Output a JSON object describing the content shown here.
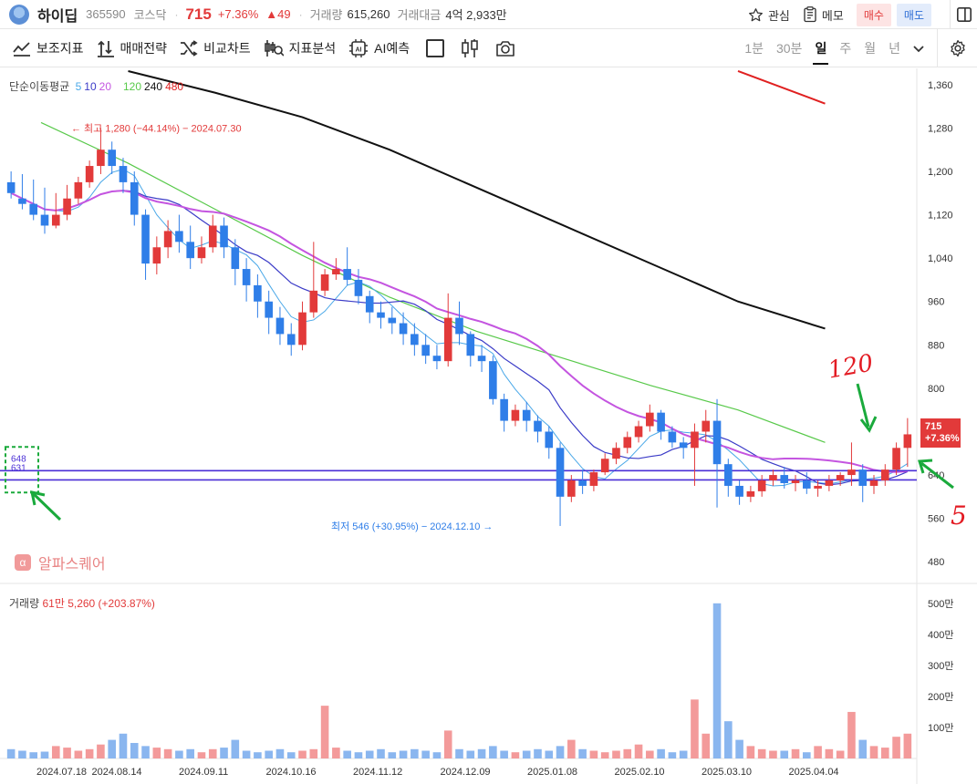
{
  "header": {
    "name": "하이딥",
    "code": "365590",
    "market": "코스닥",
    "dot": "·",
    "price": "715",
    "change_pct": "+7.36%",
    "change_abs": "▲49",
    "volume_label": "거래량",
    "volume_value": "615,260",
    "amount_label": "거래대금",
    "amount_value": "4억 2,933만",
    "watch_label": "관심",
    "memo_label": "메모",
    "buy_label": "매수",
    "sell_label": "매도"
  },
  "toolbar": {
    "indicators": "보조지표",
    "strategy": "매매전략",
    "compare": "비교차트",
    "indicator_analysis": "지표분석",
    "ai_predict": "AI예측",
    "timeframes": [
      "1분",
      "30분",
      "일",
      "주",
      "월",
      "년"
    ],
    "active_timeframe": "일"
  },
  "chart": {
    "ma_title": "단순이동평균",
    "ma_periods": [
      {
        "label": "5",
        "color": "#4aa8e8"
      },
      {
        "label": "10",
        "color": "#3b3bc7"
      },
      {
        "label": "20",
        "color": "#c455e0"
      },
      {
        "label": "120",
        "color": "#58c94a"
      },
      {
        "label": "240",
        "color": "#111111"
      },
      {
        "label": "480",
        "color": "#e02020"
      }
    ],
    "high_note": "최고 1,280 (−44.14%) − 2024.07.30",
    "low_note": "최저 546 (+30.95%) − 2024.12.10",
    "level_labels": [
      "648",
      "631"
    ],
    "price_tag": {
      "price": "715",
      "pct": "+7.36%"
    },
    "brand": "알파스퀘어",
    "volume_title": "거래량",
    "volume_info": "61만 5,260 (+203.87%)",
    "annotation_120": "120",
    "annotation_5": "5",
    "y_ticks": [
      "1,360",
      "1,280",
      "1,200",
      "1,120",
      "1,040",
      "960",
      "880",
      "800",
      "640",
      "560",
      "480"
    ],
    "y_ticks_values": [
      1360,
      1280,
      1200,
      1120,
      1040,
      960,
      880,
      800,
      640,
      560,
      480
    ],
    "volume_ticks": [
      "500만",
      "400만",
      "300만",
      "200만",
      "100만"
    ],
    "x_ticks": [
      "2024.07.18",
      "2024.08.14",
      "2024.09.11",
      "2024.10.16",
      "2024.11.12",
      "2024.12.09",
      "2025.01.08",
      "2025.02.10",
      "2025.03.10",
      "2025.04.04"
    ],
    "colors": {
      "up": "#e23a3a",
      "down": "#2f7ee8",
      "level": "#4a2fd6"
    }
  },
  "chart_data": {
    "type": "candlestick",
    "ylim": [
      440,
      1390
    ],
    "levels": [
      648,
      631
    ],
    "ma_lines": [
      {
        "name": "120",
        "color": "#58c94a",
        "points": [
          [
            "2024.07.18",
            1290
          ],
          [
            "2024.08.14",
            1215
          ],
          [
            "2024.09.11",
            1130
          ],
          [
            "2024.10.16",
            1045
          ],
          [
            "2024.11.12",
            968
          ],
          [
            "2024.12.09",
            905
          ],
          [
            "2025.01.08",
            855
          ],
          [
            "2025.02.10",
            805
          ],
          [
            "2025.03.10",
            760
          ],
          [
            "2025.04.04",
            700
          ]
        ]
      },
      {
        "name": "240",
        "color": "#111111",
        "points": [
          [
            "2024.08.14",
            1385
          ],
          [
            "2024.09.11",
            1345
          ],
          [
            "2024.10.16",
            1300
          ],
          [
            "2024.11.12",
            1240
          ],
          [
            "2024.12.09",
            1170
          ],
          [
            "2025.01.08",
            1100
          ],
          [
            "2025.02.10",
            1030
          ],
          [
            "2025.03.10",
            960
          ],
          [
            "2025.04.04",
            910
          ]
        ]
      },
      {
        "name": "480",
        "color": "#e02020",
        "points": [
          [
            "2025.03.10",
            1385
          ],
          [
            "2025.04.04",
            1325
          ]
        ]
      }
    ],
    "candles": [
      [
        1180,
        1200,
        1160,
        1150
      ],
      [
        1150,
        1195,
        1140,
        1130
      ],
      [
        1140,
        1185,
        1120,
        1110
      ],
      [
        1120,
        1170,
        1100,
        1085
      ],
      [
        1100,
        1160,
        1120,
        1095
      ],
      [
        1120,
        1175,
        1150,
        1110
      ],
      [
        1150,
        1190,
        1180,
        1140
      ],
      [
        1180,
        1220,
        1210,
        1170
      ],
      [
        1210,
        1280,
        1240,
        1195
      ],
      [
        1240,
        1255,
        1210,
        1195
      ],
      [
        1210,
        1225,
        1180,
        1160
      ],
      [
        1180,
        1200,
        1120,
        1100
      ],
      [
        1120,
        1130,
        1030,
        1000
      ],
      [
        1030,
        1080,
        1060,
        1010
      ],
      [
        1060,
        1110,
        1090,
        1040
      ],
      [
        1090,
        1120,
        1070,
        1050
      ],
      [
        1070,
        1100,
        1040,
        1020
      ],
      [
        1040,
        1080,
        1060,
        1030
      ],
      [
        1060,
        1120,
        1100,
        1050
      ],
      [
        1100,
        1115,
        1060,
        1040
      ],
      [
        1060,
        1075,
        1020,
        990
      ],
      [
        1020,
        1040,
        990,
        960
      ],
      [
        990,
        1010,
        960,
        930
      ],
      [
        960,
        980,
        930,
        900
      ],
      [
        930,
        950,
        900,
        880
      ],
      [
        900,
        920,
        880,
        860
      ],
      [
        880,
        960,
        940,
        870
      ],
      [
        940,
        1070,
        980,
        930
      ],
      [
        980,
        1020,
        1010,
        970
      ],
      [
        1010,
        1040,
        1020,
        1000
      ],
      [
        1020,
        1060,
        1000,
        990
      ],
      [
        1000,
        1020,
        970,
        955
      ],
      [
        970,
        980,
        940,
        920
      ],
      [
        940,
        960,
        930,
        910
      ],
      [
        930,
        950,
        920,
        900
      ],
      [
        920,
        940,
        900,
        880
      ],
      [
        900,
        920,
        880,
        860
      ],
      [
        880,
        900,
        860,
        845
      ],
      [
        860,
        880,
        850,
        835
      ],
      [
        850,
        975,
        930,
        840
      ],
      [
        930,
        960,
        900,
        880
      ],
      [
        900,
        905,
        860,
        840
      ],
      [
        860,
        880,
        850,
        830
      ],
      [
        850,
        860,
        780,
        770
      ],
      [
        780,
        790,
        740,
        720
      ],
      [
        740,
        770,
        760,
        730
      ],
      [
        760,
        775,
        740,
        720
      ],
      [
        740,
        750,
        720,
        700
      ],
      [
        720,
        730,
        690,
        670
      ],
      [
        690,
        700,
        600,
        546
      ],
      [
        600,
        640,
        630,
        590
      ],
      [
        630,
        650,
        620,
        605
      ],
      [
        620,
        650,
        645,
        610
      ],
      [
        645,
        680,
        670,
        640
      ],
      [
        670,
        700,
        690,
        660
      ],
      [
        690,
        720,
        710,
        680
      ],
      [
        710,
        740,
        730,
        700
      ],
      [
        730,
        770,
        755,
        720
      ],
      [
        755,
        760,
        720,
        705
      ],
      [
        720,
        730,
        700,
        690
      ],
      [
        700,
        710,
        690,
        670
      ],
      [
        690,
        735,
        720,
        620
      ],
      [
        720,
        760,
        740,
        700
      ],
      [
        740,
        780,
        660,
        580
      ],
      [
        660,
        670,
        620,
        600
      ],
      [
        620,
        630,
        600,
        585
      ],
      [
        600,
        620,
        610,
        590
      ],
      [
        610,
        640,
        630,
        600
      ],
      [
        630,
        650,
        640,
        620
      ],
      [
        640,
        655,
        625,
        615
      ],
      [
        625,
        640,
        630,
        610
      ],
      [
        630,
        645,
        615,
        605
      ],
      [
        615,
        630,
        620,
        600
      ],
      [
        620,
        640,
        630,
        610
      ],
      [
        630,
        645,
        640,
        620
      ],
      [
        640,
        700,
        650,
        620
      ],
      [
        650,
        660,
        620,
        590
      ],
      [
        620,
        640,
        630,
        605
      ],
      [
        630,
        660,
        650,
        620
      ],
      [
        650,
        700,
        690,
        640
      ],
      [
        690,
        745,
        715,
        655
      ]
    ]
  },
  "volume_data": [
    30,
    25,
    20,
    22,
    40,
    35,
    25,
    30,
    45,
    60,
    80,
    50,
    40,
    35,
    30,
    25,
    30,
    20,
    30,
    35,
    60,
    25,
    20,
    25,
    30,
    20,
    25,
    30,
    170,
    35,
    25,
    20,
    25,
    30,
    20,
    25,
    30,
    25,
    20,
    90,
    30,
    25,
    30,
    40,
    25,
    20,
    25,
    30,
    25,
    40,
    60,
    30,
    25,
    20,
    25,
    30,
    45,
    25,
    30,
    20,
    25,
    190,
    80,
    500,
    120,
    60,
    40,
    30,
    25,
    25,
    30,
    20,
    40,
    30,
    25,
    150,
    60,
    40,
    35,
    70,
    80
  ]
}
